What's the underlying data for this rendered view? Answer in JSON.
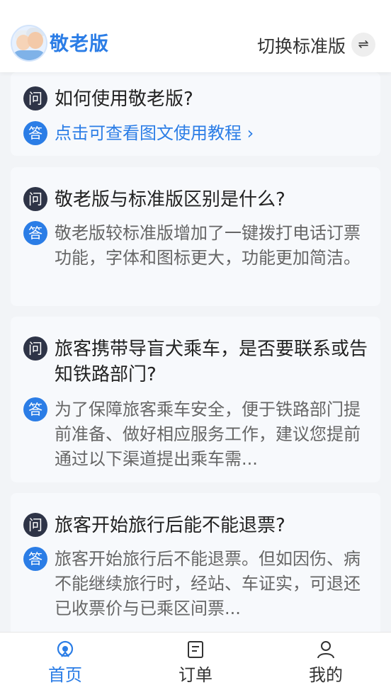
{
  "header": {
    "brand": "敬老版",
    "switch_label": "切换标准版",
    "switch_icon": "⇌"
  },
  "faq": [
    {
      "q_badge": "问",
      "question": "如何使用敬老版?",
      "a_badge": "答",
      "answer": "点击可查看图文使用教程",
      "answer_link_arrow": "›"
    },
    {
      "q_badge": "问",
      "question": "敬老版与标准版区别是什么?",
      "a_badge": "答",
      "answer": "敬老版较标准版增加了一键拨打电话订票功能，字体和图标更大，功能更加简洁。"
    },
    {
      "q_badge": "问",
      "question": "旅客携带导盲犬乘车，是否要联系或告知铁路部门?",
      "a_badge": "答",
      "answer": "为了保障旅客乘车安全，便于铁路部门提前准备、做好相应服务工作，建议您提前通过以下渠道提出乘车需..."
    },
    {
      "q_badge": "问",
      "question": "旅客开始旅行后能不能退票?",
      "a_badge": "答",
      "answer": "旅客开始旅行后不能退票。但如因伤、病不能继续旅行时，经站、车证实，可退还已收票价与已乘区间票..."
    }
  ],
  "tabbar": {
    "tabs": [
      {
        "label": "首页",
        "icon": "home-icon",
        "active": true
      },
      {
        "label": "订单",
        "icon": "order-icon",
        "active": false
      },
      {
        "label": "我的",
        "icon": "profile-icon",
        "active": false
      }
    ],
    "active_color": "#2b7de6"
  }
}
